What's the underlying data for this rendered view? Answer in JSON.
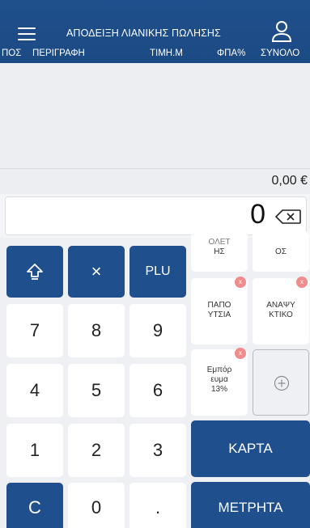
{
  "header": {
    "title": "ΑΠΟΔΕΙΞΗ ΛΙΑΝΙΚΗΣ ΠΩΛΗΣΗΣ",
    "menu_icon": "hamburger-icon",
    "user_icon": "user-icon"
  },
  "columns": [
    "ΠΟΣ",
    "ΠΕΡΙΓΡΑΦΗ",
    "ΤΙΜΗ.Μ",
    "ΦΠΑ%",
    "ΣΥΝΟΛΟ"
  ],
  "total": "0,00 €",
  "entry": {
    "value": "0",
    "backspace_icon": "backspace-icon"
  },
  "keypad": {
    "shift_icon": "shift-arrow-icon",
    "multiply": "×",
    "plu": "PLU",
    "digits": [
      "7",
      "8",
      "9",
      "4",
      "5",
      "6",
      "1",
      "2",
      "3"
    ],
    "clear": "C",
    "zero": "0",
    "decimal": "."
  },
  "quick_items": [
    {
      "label_line1": "ΟΛΕΤ",
      "label_line2": "ΗΣ",
      "removable": false
    },
    {
      "label_line1": "",
      "label_line2": "ΟΣ",
      "removable": false
    },
    {
      "label_line1": "ΠΑΠΟ",
      "label_line2": "ΥΤΣΙΑ",
      "removable": true
    },
    {
      "label_line1": "ΑΝΑΨΥ",
      "label_line2": "ΚΤΙΚΟ",
      "removable": true
    },
    {
      "label_line1": "Εμπόρ",
      "label_line2": "ευμα",
      "label_line3": "13%",
      "removable": true
    }
  ],
  "remove_badge": "x",
  "add_item_icon": "plus-circle-icon",
  "payments": {
    "card": "ΚΑΡΤΑ",
    "cash": "ΜΕΤΡΗΤΑ"
  },
  "colors": {
    "primary": "#1f4f8c",
    "badge": "#f08c8c",
    "background": "#eef0f3"
  }
}
